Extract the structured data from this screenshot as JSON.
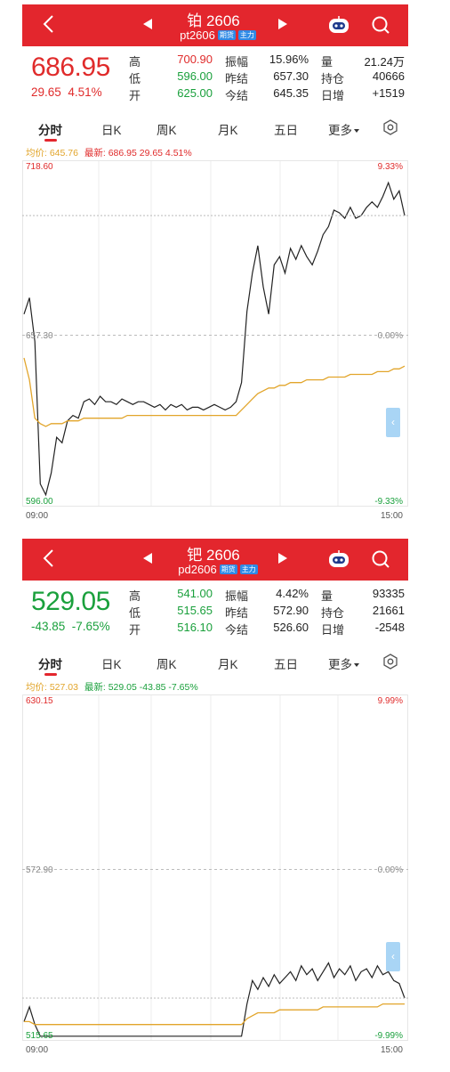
{
  "panels": [
    {
      "id": "pt",
      "title": "铂 2606",
      "code": "pt2606",
      "tags": [
        "期货",
        "主力"
      ],
      "price": "686.95",
      "change": "29.65",
      "change_pct": "4.51%",
      "trend_color": "#e02b2b",
      "stats": {
        "high_label": "高",
        "high": "700.90",
        "low_label": "低",
        "low": "596.00",
        "open_label": "开",
        "open": "625.00",
        "amplitude_label": "振幅",
        "amplitude": "15.96%",
        "prev_settle_label": "昨结",
        "prev_settle": "657.30",
        "today_settle_label": "今结",
        "today_settle": "645.35",
        "volume_label": "量",
        "volume": "21.24万",
        "open_interest_label": "持仓",
        "open_interest": "40666",
        "daily_increase_label": "日增",
        "daily_increase": "+1519"
      },
      "tabs": [
        "分时",
        "日K",
        "周K",
        "月K",
        "五日",
        "更多"
      ],
      "avg_label": "均价: 645.76",
      "latest_label": "最新: 686.95  29.65  4.51%",
      "y_top": "718.60",
      "y_mid": "657.30",
      "y_bottom": "596.00",
      "pct_top": "9.33%",
      "pct_mid": "0.00%",
      "pct_bottom": "-9.33%",
      "time_start": "09:00",
      "time_end": "15:00",
      "chart_data": {
        "type": "line",
        "ylim": [
          596.0,
          718.6
        ],
        "series": [
          {
            "values": [
              665,
              671,
              655,
              603,
              599,
              607,
              620,
              618,
              626,
              628,
              627,
              633,
              634,
              632,
              635,
              633,
              633,
              632,
              634,
              633,
              632,
              633,
              633,
              632,
              631,
              632,
              630,
              632,
              631,
              632,
              630,
              631,
              631,
              630,
              631,
              632,
              631,
              630,
              631,
              633,
              640,
              666,
              680,
              690,
              675,
              665,
              683,
              686,
              680,
              689,
              685,
              690,
              686,
              683,
              688,
              694,
              697,
              703,
              702,
              700,
              704,
              700,
              701,
              704,
              706,
              704,
              708,
              713,
              707,
              710,
              701
            ]
          },
          {
            "values": [
              649,
              641,
              627,
              625,
              624,
              625,
              625,
              625,
              626,
              626,
              626,
              627,
              627,
              627,
              627,
              627,
              627,
              627,
              627,
              628,
              628,
              628,
              628,
              628,
              628,
              628,
              628,
              628,
              628,
              628,
              628,
              628,
              628,
              628,
              628,
              628,
              628,
              628,
              628,
              628,
              630,
              632,
              634,
              636,
              637,
              638,
              638,
              639,
              639,
              640,
              640,
              640,
              641,
              641,
              641,
              641,
              642,
              642,
              642,
              642,
              643,
              643,
              643,
              643,
              643,
              644,
              644,
              644,
              645,
              645,
              646
            ]
          }
        ]
      }
    },
    {
      "id": "pd",
      "title": "钯 2606",
      "code": "pd2606",
      "tags": [
        "期货",
        "主力"
      ],
      "price": "529.05",
      "change": "-43.85",
      "change_pct": "-7.65%",
      "trend_color": "#1aa03c",
      "stats": {
        "high_label": "高",
        "high": "541.00",
        "low_label": "低",
        "low": "515.65",
        "open_label": "开",
        "open": "516.10",
        "amplitude_label": "振幅",
        "amplitude": "4.42%",
        "prev_settle_label": "昨结",
        "prev_settle": "572.90",
        "today_settle_label": "今结",
        "today_settle": "526.60",
        "volume_label": "量",
        "volume": "93335",
        "open_interest_label": "持仓",
        "open_interest": "21661",
        "daily_increase_label": "日增",
        "daily_increase": "-2548"
      },
      "tabs": [
        "分时",
        "日K",
        "周K",
        "月K",
        "五日",
        "更多"
      ],
      "avg_label": "均价: 527.03",
      "latest_label": "最新: 529.05  -43.85  -7.65%",
      "y_top": "630.15",
      "y_mid": "572.90",
      "y_bottom": "515.65",
      "pct_top": "9.99%",
      "pct_mid": "0.00%",
      "pct_bottom": "-9.99%",
      "time_start": "09:00",
      "time_end": "15:00",
      "chart_data": {
        "type": "line",
        "ylim": [
          515.65,
          630.15
        ],
        "series": [
          {
            "values": [
              521,
              526,
              520,
              516,
              516,
              516,
              516,
              516,
              516,
              516,
              516,
              516,
              516,
              516,
              516,
              516,
              516,
              516,
              516,
              516,
              516,
              516,
              516,
              516,
              516,
              516,
              516,
              516,
              516,
              516,
              516,
              516,
              516,
              516,
              516,
              516,
              516,
              516,
              516,
              516,
              516,
              527,
              535,
              532,
              536,
              533,
              537,
              534,
              536,
              538,
              535,
              540,
              537,
              539,
              535,
              538,
              541,
              536,
              539,
              537,
              540,
              535,
              538,
              539,
              536,
              540,
              537,
              538,
              535,
              534,
              529
            ]
          },
          {
            "values": [
              521,
              521,
              520,
              520,
              520,
              520,
              520,
              520,
              520,
              520,
              520,
              520,
              520,
              520,
              520,
              520,
              520,
              520,
              520,
              520,
              520,
              520,
              520,
              520,
              520,
              520,
              520,
              520,
              520,
              520,
              520,
              520,
              520,
              520,
              520,
              520,
              520,
              520,
              520,
              520,
              520,
              522,
              523,
              524,
              524,
              524,
              524,
              525,
              525,
              525,
              525,
              525,
              525,
              525,
              525,
              526,
              526,
              526,
              526,
              526,
              526,
              526,
              526,
              526,
              526,
              526,
              527,
              527,
              527,
              527,
              527
            ]
          }
        ]
      }
    }
  ]
}
